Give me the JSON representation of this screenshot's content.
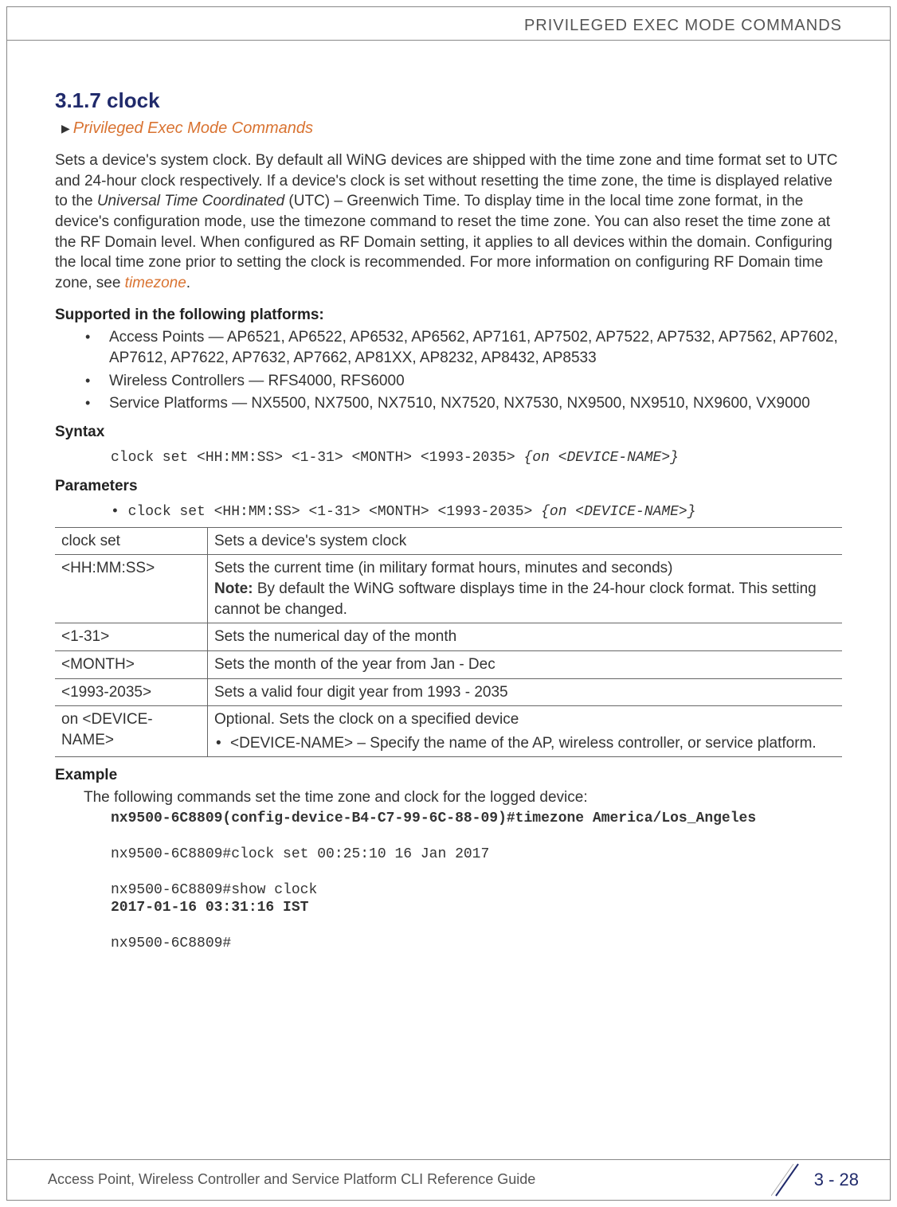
{
  "header": {
    "breadcrumb": "PRIVILEGED EXEC MODE COMMANDS"
  },
  "section": {
    "number_title": "3.1.7 clock",
    "breadcrumb_link": "Privileged Exec Mode Commands",
    "intro_pre": "Sets a device's system clock. By default all WiNG devices are shipped with the time zone and time format set to UTC and 24-hour clock respectively. If a device's clock is set without resetting the time zone, the time is displayed relative to the ",
    "intro_italic": "Universal Time Coordinated",
    "intro_post": " (UTC) – Greenwich Time. To display time in the local time zone format, in the device's configuration mode, use the timezone command to reset the time zone. You can also reset the time zone at the RF Domain level. When configured as RF Domain setting, it applies to all devices within the domain. Configuring the local time zone prior to setting the clock is recommended. For more information on configuring RF Domain time zone, see ",
    "intro_link": "timezone",
    "intro_end": "."
  },
  "supported": {
    "heading": "Supported in the following platforms:",
    "items": [
      "Access Points — AP6521, AP6522, AP6532, AP6562, AP7161, AP7502, AP7522, AP7532, AP7562, AP7602, AP7612, AP7622, AP7632, AP7662, AP81XX, AP8232, AP8432, AP8533",
      "Wireless Controllers — RFS4000, RFS6000",
      "Service Platforms — NX5500, NX7500, NX7510, NX7520, NX7530, NX9500, NX9510, NX9600, VX9000"
    ]
  },
  "syntax": {
    "heading": "Syntax",
    "line_plain": "clock set <HH:MM:SS> <1-31> <MONTH> <1993-2035> ",
    "line_italic": "{on <DEVICE-NAME>}"
  },
  "parameters": {
    "heading": "Parameters",
    "bullet_plain": "clock set <HH:MM:SS> <1-31> <MONTH> <1993-2035> ",
    "bullet_italic": "{on <DEVICE-NAME>}",
    "rows": [
      {
        "p": "clock set",
        "d": "Sets a device's system clock"
      },
      {
        "p": "<HH:MM:SS>",
        "d": "Sets the current time (in military format hours, minutes and seconds)",
        "note_label": "Note:",
        "note": " By default the WiNG software displays time in the 24-hour clock format. This setting cannot be changed."
      },
      {
        "p": "<1-31>",
        "d": "Sets the numerical day of the month"
      },
      {
        "p": "<MONTH>",
        "d": "Sets the month of the year from Jan - Dec"
      },
      {
        "p": "<1993-2035>",
        "d": "Sets a valid four digit year from 1993 - 2035"
      },
      {
        "p": "on <DEVICE-NAME>",
        "d": "Optional. Sets the clock on a specified device",
        "sub": "<DEVICE-NAME> – Specify the name of the AP, wireless controller, or service platform."
      }
    ]
  },
  "example": {
    "heading": "Example",
    "intro": "The following commands set the time zone and clock for the logged device:",
    "line1_bold": "nx9500-6C8809(config-device-B4-C7-99-6C-88-09)#timezone America/Los_Angeles",
    "line2": "nx9500-6C8809#clock set 00:25:10 16 Jan 2017",
    "line3": "nx9500-6C8809#show clock",
    "line4_bold": "2017-01-16 03:31:16 IST",
    "line5": "nx9500-6C8809#"
  },
  "footer": {
    "left": "Access Point, Wireless Controller and Service Platform CLI Reference Guide",
    "right": "3 - 28"
  }
}
